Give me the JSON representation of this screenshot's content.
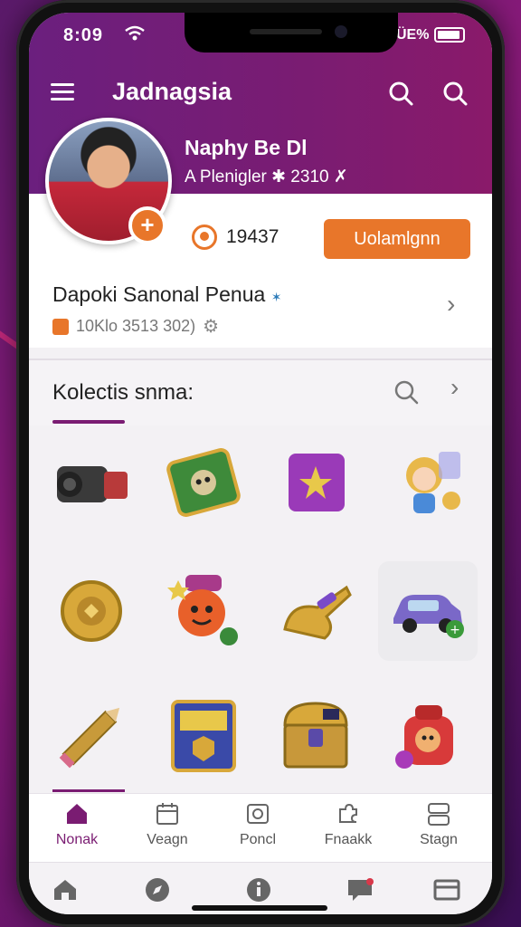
{
  "status": {
    "time": "8:09",
    "battery_text": "ÜE%"
  },
  "app_bar": {
    "title": "Jadnagsia"
  },
  "profile": {
    "name": "Naphy Be Dl",
    "subtitle": "A Plenigler ✱ 2310 ✗",
    "coins": "19437",
    "action_label": "Uolamlgnn",
    "badge": "+"
  },
  "info_row": {
    "title": "Dapoki Sanonal Penua",
    "title_accent": "✶",
    "subtitle": "10Klo 3513 302)"
  },
  "collection": {
    "title": "Kolectis snma:"
  },
  "grid_items": [
    {
      "icon": "camera-icon",
      "color": "#3a3a3a"
    },
    {
      "icon": "robot-box-icon",
      "color": "#3e8a3a"
    },
    {
      "icon": "purple-box-icon",
      "color": "#9a3ab8"
    },
    {
      "icon": "girl-character-icon",
      "color": "#e8b84a"
    },
    {
      "icon": "gold-ring-icon",
      "color": "#d8a83a"
    },
    {
      "icon": "orange-character-icon",
      "color": "#e8602a"
    },
    {
      "icon": "gold-shoe-icon",
      "color": "#d8a83a"
    },
    {
      "icon": "car-icon",
      "color": "#7a68c8"
    },
    {
      "icon": "pencil-icon",
      "color": "#c89a3a"
    },
    {
      "icon": "card-icon",
      "color": "#3a4aa8"
    },
    {
      "icon": "treasure-chest-icon",
      "color": "#c8983a"
    },
    {
      "icon": "red-character-icon",
      "color": "#d83a3a"
    }
  ],
  "tabs": [
    {
      "label": "Nonak",
      "icon": "home-icon"
    },
    {
      "label": "Veagn",
      "icon": "calendar-icon"
    },
    {
      "label": "Poncl",
      "icon": "photo-icon"
    },
    {
      "label": "Fnaakk",
      "icon": "puzzle-icon"
    },
    {
      "label": "Stagn",
      "icon": "cards-icon"
    }
  ],
  "colors": {
    "brand": "#7a1c72",
    "accent": "#e8762a"
  }
}
